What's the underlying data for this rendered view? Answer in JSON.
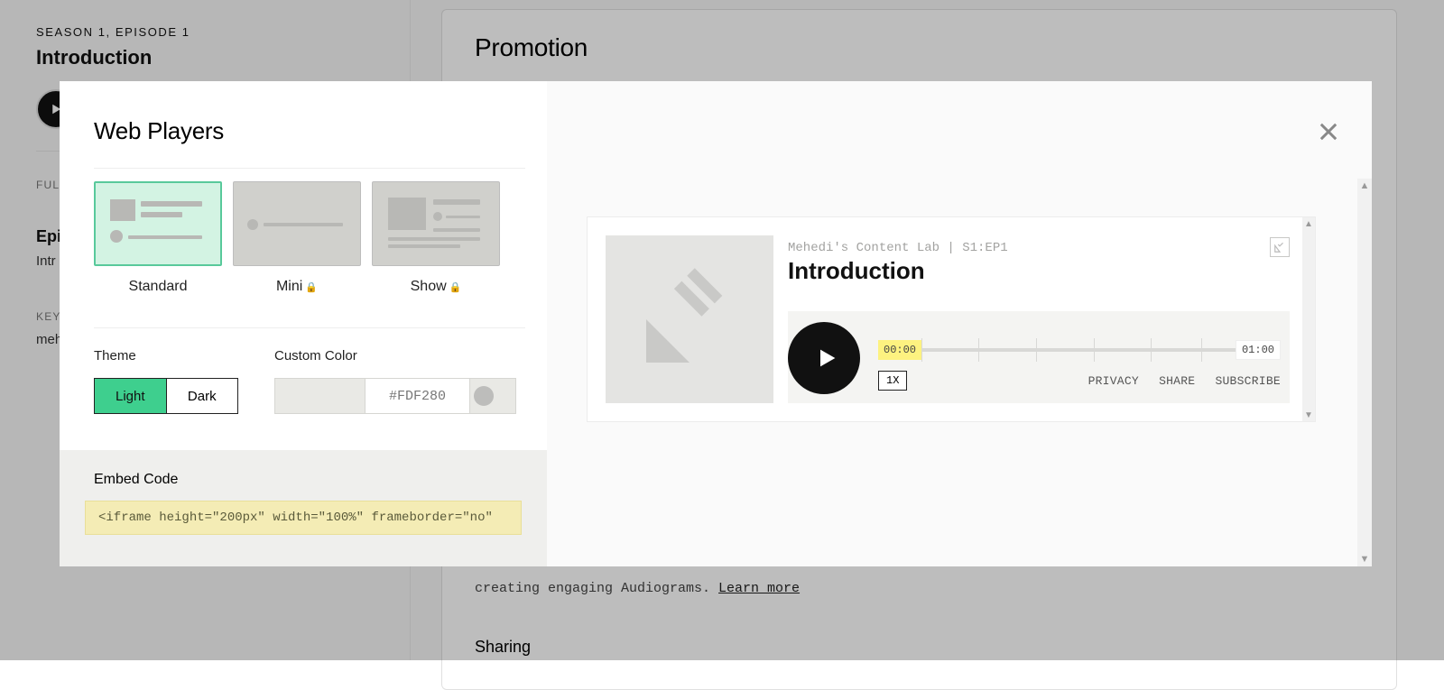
{
  "bg": {
    "eyebrow": "SEASON 1, EPISODE 1",
    "title": "Introduction",
    "full_label": "FULL",
    "episode_label": "Epis",
    "episode_value": "Intr",
    "keywords_label": "KEYW",
    "keywords_value": "meh",
    "promo_heading": "Promotion",
    "promo_body": "creating engaging Audiograms. ",
    "promo_link": "Learn more",
    "sharing_heading": "Sharing"
  },
  "modal": {
    "heading": "Web Players",
    "options": [
      {
        "label": "Standard",
        "locked": false
      },
      {
        "label": "Mini",
        "locked": true
      },
      {
        "label": "Show",
        "locked": true
      }
    ],
    "theme_label": "Theme",
    "theme_light": "Light",
    "theme_dark": "Dark",
    "custom_color_label": "Custom Color",
    "custom_color_value": "#FDF280",
    "embed_label": "Embed Code",
    "embed_code": "<iframe height=\"200px\" width=\"100%\" frameborder=\"no\""
  },
  "preview": {
    "crumb": "Mehedi's Content Lab | S1:EP1",
    "title": "Introduction",
    "time_start": "00:00",
    "time_end": "01:00",
    "speed": "1X",
    "links": [
      "PRIVACY",
      "SHARE",
      "SUBSCRIBE"
    ]
  }
}
